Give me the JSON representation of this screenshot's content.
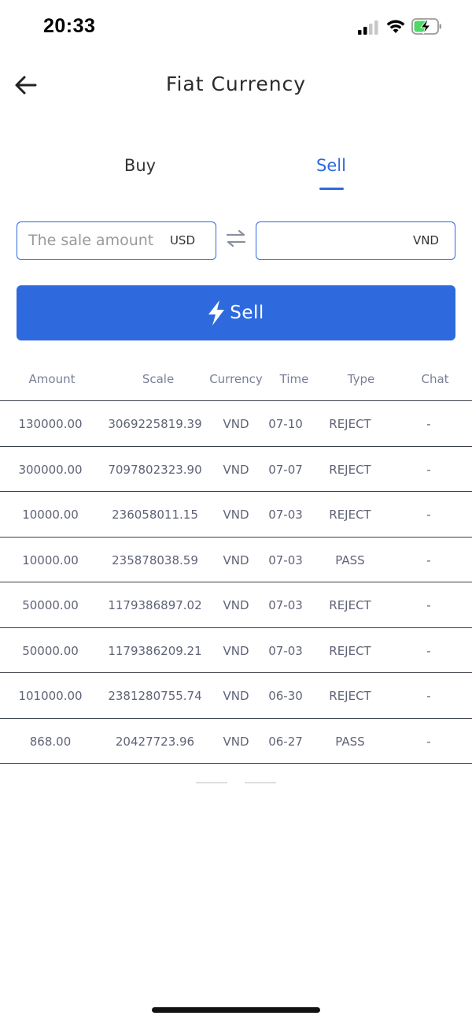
{
  "status_bar": {
    "time": "20:33",
    "icons": [
      "cellular-signal-icon",
      "wifi-icon",
      "battery-charging-icon"
    ]
  },
  "header": {
    "title": "Fiat Currency",
    "back_icon": "back-arrow-icon"
  },
  "tabs": [
    {
      "label": "Buy",
      "active": false
    },
    {
      "label": "Sell",
      "active": true
    }
  ],
  "exchange": {
    "from": {
      "placeholder": "The sale amount",
      "value": "",
      "currency": "USD"
    },
    "swap_icon": "swap-arrows-icon",
    "to": {
      "value": "",
      "currency": "VND"
    }
  },
  "action": {
    "label": "Sell",
    "icon": "lightning-bolt-icon"
  },
  "table": {
    "columns": [
      "Amount",
      "Scale",
      "Currency",
      "Time",
      "Type",
      "Chat"
    ],
    "rows": [
      {
        "amount": "130000.00",
        "scale": "3069225819.39",
        "currency": "VND",
        "time": "07-10",
        "type": "REJECT",
        "chat": "-"
      },
      {
        "amount": "300000.00",
        "scale": "7097802323.90",
        "currency": "VND",
        "time": "07-07",
        "type": "REJECT",
        "chat": "-"
      },
      {
        "amount": "10000.00",
        "scale": "236058011.15",
        "currency": "VND",
        "time": "07-03",
        "type": "REJECT",
        "chat": "-"
      },
      {
        "amount": "10000.00",
        "scale": "235878038.59",
        "currency": "VND",
        "time": "07-03",
        "type": "PASS",
        "chat": "-"
      },
      {
        "amount": "50000.00",
        "scale": "1179386897.02",
        "currency": "VND",
        "time": "07-03",
        "type": "REJECT",
        "chat": "-"
      },
      {
        "amount": "50000.00",
        "scale": "1179386209.21",
        "currency": "VND",
        "time": "07-03",
        "type": "REJECT",
        "chat": "-"
      },
      {
        "amount": "101000.00",
        "scale": "2381280755.74",
        "currency": "VND",
        "time": "06-30",
        "type": "REJECT",
        "chat": "-"
      },
      {
        "amount": "868.00",
        "scale": "20427723.96",
        "currency": "VND",
        "time": "06-27",
        "type": "PASS",
        "chat": "-"
      }
    ]
  },
  "colors": {
    "accent": "#2e6ade",
    "header_text": "#7a7f96",
    "cell_text": "#5f6377",
    "divider": "#3a3f4c"
  }
}
